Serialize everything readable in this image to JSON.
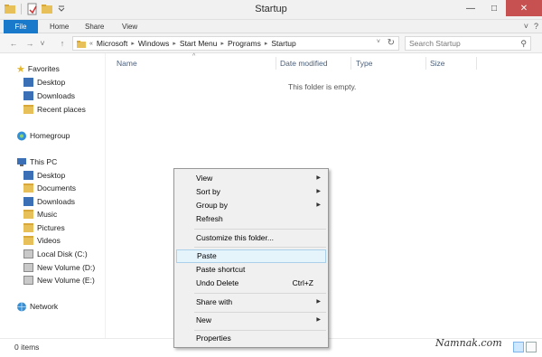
{
  "window": {
    "title": "Startup",
    "minimize": "—",
    "maximize": "□",
    "close": "✕"
  },
  "ribbon": {
    "tabs": [
      "File",
      "Home",
      "Share",
      "View"
    ],
    "collapse": "˅",
    "help": "?"
  },
  "nav": {
    "back": "←",
    "forward": "→",
    "history": "˅",
    "up": "↑"
  },
  "address": {
    "overflow": "«",
    "crumbs": [
      "Microsoft",
      "Windows",
      "Start Menu",
      "Programs",
      "Startup"
    ],
    "dropdown": "˅",
    "refresh": "↻"
  },
  "search": {
    "placeholder": "Search Startup",
    "icon": "search-icon"
  },
  "navpane": {
    "favorites": {
      "label": "Favorites",
      "items": [
        "Desktop",
        "Downloads",
        "Recent places"
      ]
    },
    "homegroup": "Homegroup",
    "thispc": {
      "label": "This PC",
      "items": [
        "Desktop",
        "Documents",
        "Downloads",
        "Music",
        "Pictures",
        "Videos",
        "Local Disk (C:)",
        "New Volume (D:)",
        "New Volume (E:)"
      ]
    },
    "network": "Network"
  },
  "columns": [
    "Name",
    "Date modified",
    "Type",
    "Size"
  ],
  "sort_indicator": "^",
  "empty_message": "This folder is empty.",
  "status": {
    "count": "0 items"
  },
  "watermark": "Namnak.com",
  "context_menu": {
    "items": [
      {
        "label": "View",
        "submenu": true
      },
      {
        "label": "Sort by",
        "submenu": true
      },
      {
        "label": "Group by",
        "submenu": true
      },
      {
        "label": "Refresh",
        "submenu": false
      },
      {
        "label": "Customize this folder...",
        "submenu": false
      },
      {
        "label": "Paste",
        "submenu": false,
        "highlighted": true
      },
      {
        "label": "Paste shortcut",
        "submenu": false
      },
      {
        "label": "Undo Delete",
        "submenu": false,
        "shortcut": "Ctrl+Z"
      },
      {
        "label": "Share with",
        "submenu": true
      },
      {
        "label": "New",
        "submenu": true
      },
      {
        "label": "Properties",
        "submenu": false
      }
    ],
    "submenu_arrow": "▶"
  },
  "colors": {
    "file_tab": "#1979ca",
    "close_button": "#c75050",
    "highlight": "#e5f3fb",
    "folder": "#e8c05a"
  }
}
